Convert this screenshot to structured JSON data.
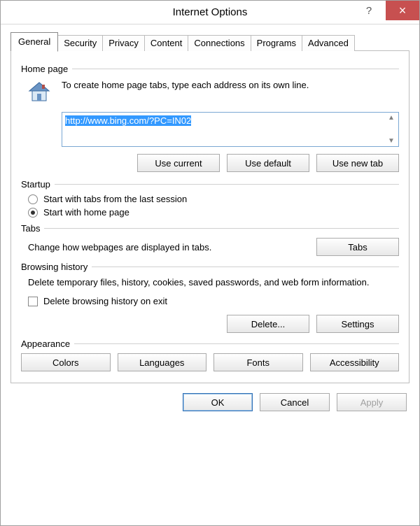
{
  "window": {
    "title": "Internet Options",
    "help_tooltip": "?",
    "close_tooltip": "×"
  },
  "tabs": [
    {
      "label": "General",
      "active": true
    },
    {
      "label": "Security",
      "active": false
    },
    {
      "label": "Privacy",
      "active": false
    },
    {
      "label": "Content",
      "active": false
    },
    {
      "label": "Connections",
      "active": false
    },
    {
      "label": "Programs",
      "active": false
    },
    {
      "label": "Advanced",
      "active": false
    }
  ],
  "homepage": {
    "section_label": "Home page",
    "instruction": "To create home page tabs, type each address on its own line.",
    "url_value": "http://www.bing.com/?PC=IN02",
    "use_current": "Use current",
    "use_default": "Use default",
    "use_new_tab": "Use new tab"
  },
  "startup": {
    "section_label": "Startup",
    "option_last_session": "Start with tabs from the last session",
    "option_home_page": "Start with home page",
    "selected": "home_page"
  },
  "tabs_section": {
    "section_label": "Tabs",
    "desc": "Change how webpages are displayed in tabs.",
    "button": "Tabs"
  },
  "history": {
    "section_label": "Browsing history",
    "desc": "Delete temporary files, history, cookies, saved passwords, and web form information.",
    "checkbox_label": "Delete browsing history on exit",
    "checked": false,
    "delete_button": "Delete...",
    "settings_button": "Settings"
  },
  "appearance": {
    "section_label": "Appearance",
    "colors": "Colors",
    "languages": "Languages",
    "fonts": "Fonts",
    "accessibility": "Accessibility"
  },
  "dialog": {
    "ok": "OK",
    "cancel": "Cancel",
    "apply": "Apply"
  }
}
